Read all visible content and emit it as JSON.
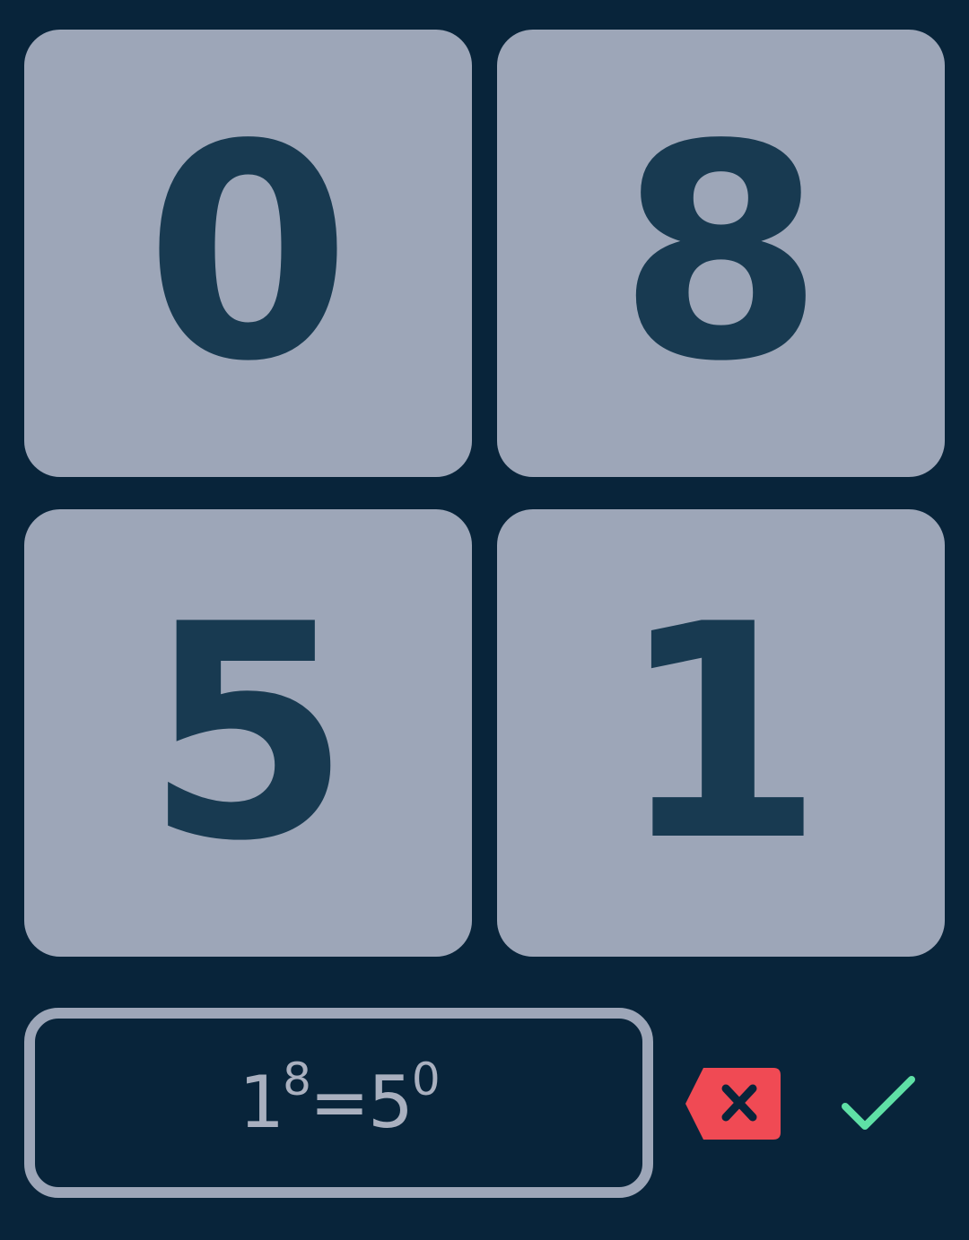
{
  "tiles": [
    "0",
    "8",
    "5",
    "1"
  ],
  "answer": {
    "base1": "1",
    "exp1": "8",
    "equals": "=",
    "base2": "5",
    "exp2": "0"
  },
  "controls": {
    "backspace_icon": "backspace-x-icon",
    "confirm_icon": "checkmark-icon"
  },
  "colors": {
    "background": "#08243a",
    "tile": "#9da6b8",
    "tile_digit": "#183a51",
    "backspace": "#f04a54",
    "confirm": "#5fe0a6"
  }
}
